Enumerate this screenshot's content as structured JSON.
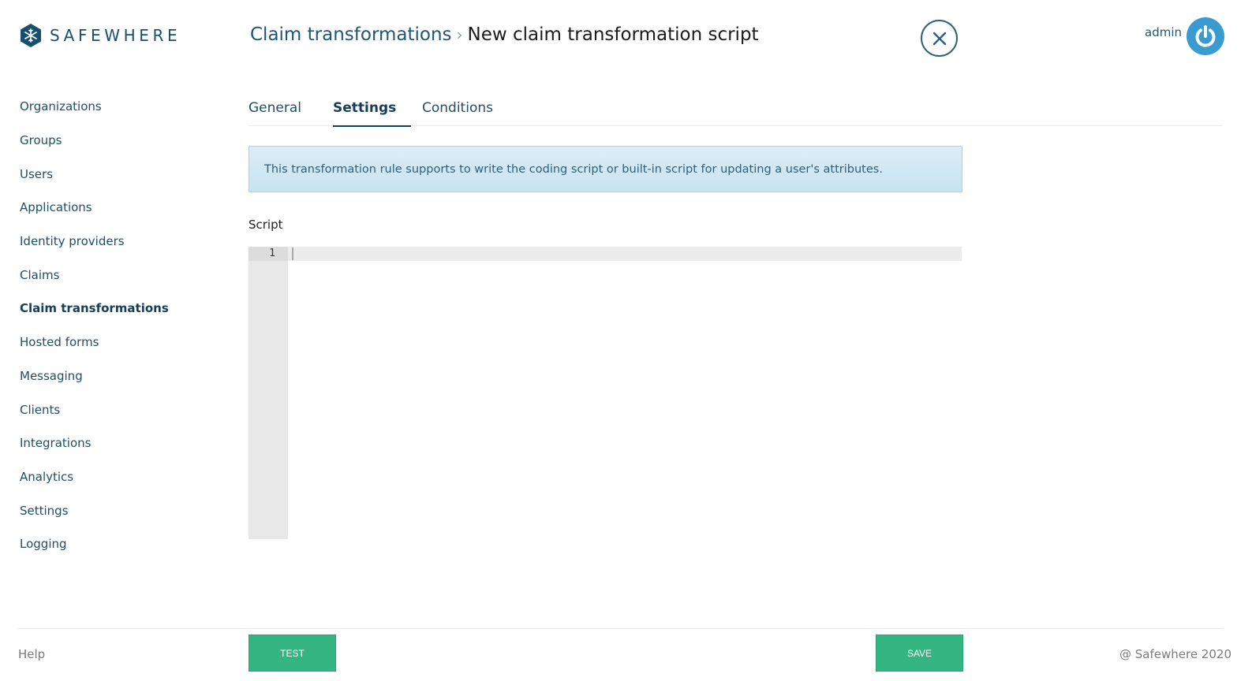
{
  "brand": {
    "name": "SAFEWHERE",
    "logo_icon": "snowflake-hexagon-icon",
    "color": "#17506f"
  },
  "header": {
    "breadcrumb_parent": "Claim transformations",
    "breadcrumb_separator": "›",
    "breadcrumb_current": "New claim transformation script",
    "close_icon": "close-icon"
  },
  "user": {
    "name": "admin",
    "power_icon": "power-icon",
    "avatar_color": "#3a9bd0"
  },
  "sidebar": {
    "items": [
      {
        "label": "Organizations"
      },
      {
        "label": "Groups"
      },
      {
        "label": "Users"
      },
      {
        "label": "Applications"
      },
      {
        "label": "Identity providers"
      },
      {
        "label": "Claims"
      },
      {
        "label": "Claim transformations",
        "active": true
      },
      {
        "label": "Hosted forms"
      },
      {
        "label": "Messaging"
      },
      {
        "label": "Clients"
      },
      {
        "label": "Integrations"
      },
      {
        "label": "Analytics"
      },
      {
        "label": "Settings"
      },
      {
        "label": "Logging"
      }
    ]
  },
  "tabs": [
    {
      "label": "General"
    },
    {
      "label": "Settings",
      "active": true
    },
    {
      "label": "Conditions"
    }
  ],
  "info": {
    "message": "This transformation rule supports to write the coding script or built-in script for updating a user's attributes."
  },
  "script": {
    "label": "Script",
    "line_numbers": [
      "1"
    ],
    "content": ""
  },
  "footer": {
    "help": "Help",
    "test_label": "TEST",
    "save_label": "SAVE",
    "copyright": "@ Safewhere 2020",
    "button_color": "#33b480"
  }
}
